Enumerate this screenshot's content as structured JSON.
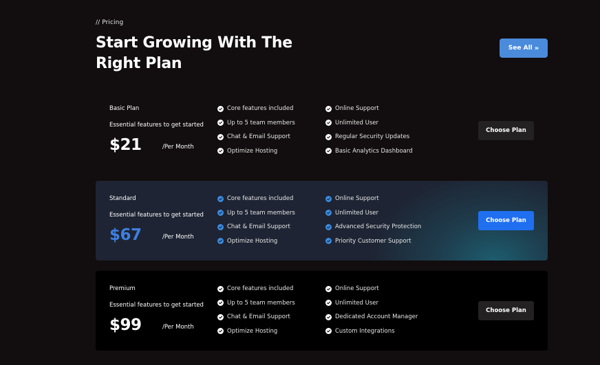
{
  "section": {
    "eyebrow": "// Pricing",
    "title": "Start Growing With The Right Plan",
    "see_all_label": "See All",
    "see_all_icon": "double-chevron-right-icon"
  },
  "colors": {
    "background": "#120d0e",
    "accent": "#4a8bdc",
    "standard_price": "#3f7fe0",
    "standard_button": "#1f6ff0",
    "standard_check": "#3b8ce0"
  },
  "plans": [
    {
      "name": "Basic Plan",
      "description": "Essential features to get started",
      "price": "$21",
      "period": "/Per Month",
      "features_left": [
        "Core features included",
        "Up to 5 team members",
        "Chat & Email Support",
        "Optimize Hosting"
      ],
      "features_right": [
        "Online Support",
        "Unlimited User",
        "Regular Security Updates",
        "Basic Analytics Dashboard"
      ],
      "button": "Choose Plan"
    },
    {
      "name": "Standard",
      "description": "Essential features to get started",
      "price": "$67",
      "period": "/Per Month",
      "features_left": [
        "Core features included",
        "Up to 5 team members",
        "Chat & Email Support",
        "Optimize Hosting"
      ],
      "features_right": [
        "Online Support",
        "Unlimited User",
        "Advanced Security Protection",
        "Priority Customer Support"
      ],
      "button": "Choose Plan"
    },
    {
      "name": "Premium",
      "description": "Essential features to get started",
      "price": "$99",
      "period": "/Per Month",
      "features_left": [
        "Core features included",
        "Up to 5 team members",
        "Chat & Email Support",
        "Optimize Hosting"
      ],
      "features_right": [
        "Online Support",
        "Unlimited User",
        "Dedicated Account Manager",
        "Custom Integrations"
      ],
      "button": "Choose Plan"
    }
  ]
}
